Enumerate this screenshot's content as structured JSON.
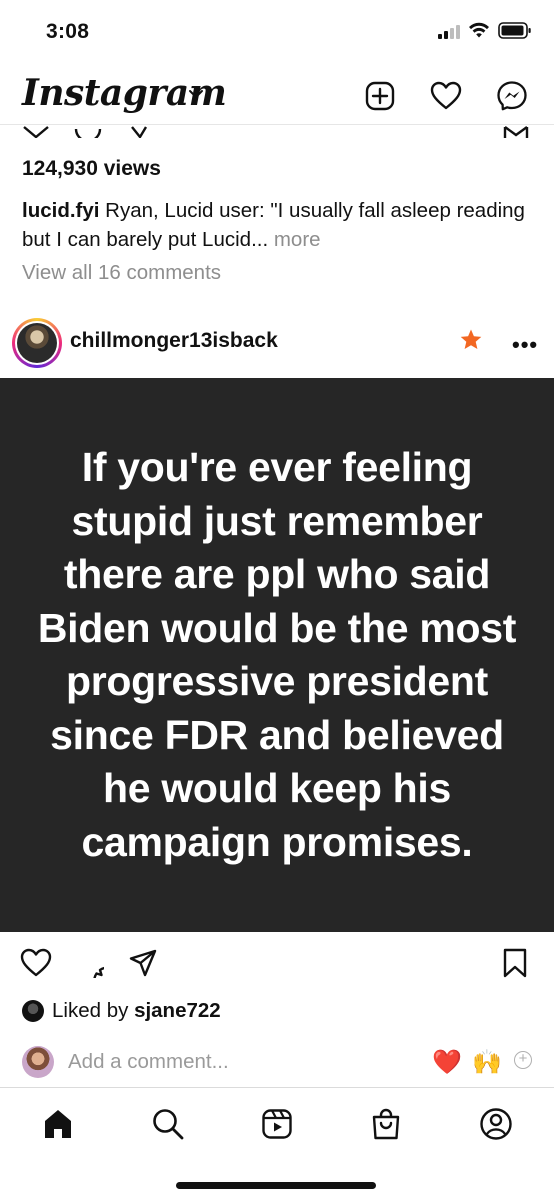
{
  "status_bar": {
    "time": "3:08"
  },
  "header": {
    "logo_text": "Instagram",
    "icons": [
      "chevron-down-icon",
      "new-post-icon",
      "heart-icon",
      "messenger-icon"
    ]
  },
  "previous_post": {
    "views": "124,930 views",
    "caption_user": "lucid.fyi",
    "caption_text": " Ryan, Lucid user: \"I usually fall asleep reading but I can barely put Lucid...",
    "caption_more": " more",
    "view_comments": "View all 16 comments"
  },
  "post": {
    "username": "chillmonger13isback",
    "more_label": "•••",
    "image_text": "If you're ever feeling stupid just remember there are ppl who said Biden would be the most progressive president since FDR and believed he would keep his campaign promises.",
    "liked_by_prefix": "Liked by ",
    "liked_by_user": "sjane722",
    "comment_placeholder": "Add a comment...",
    "quick_emojis": [
      "❤️",
      "🙌"
    ],
    "plus_label": "+"
  },
  "colors": {
    "image_background": "#262626",
    "favorite_star": "#f26722",
    "secondary_text": "#8e8e8e"
  },
  "bottom_nav": {
    "items": [
      "home-icon",
      "search-icon",
      "reels-icon",
      "shop-icon",
      "profile-icon"
    ]
  }
}
